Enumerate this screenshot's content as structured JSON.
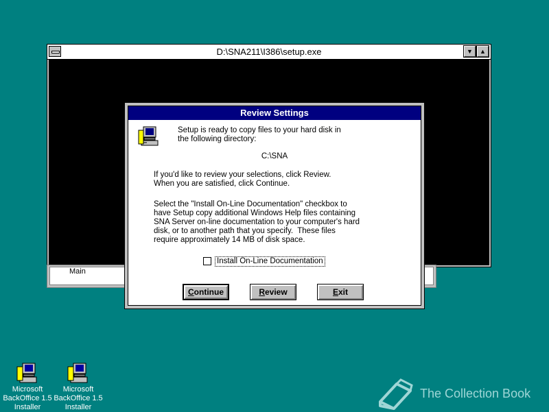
{
  "setup_window": {
    "title": "D:\\SNA211\\I386\\setup.exe"
  },
  "behind_window": {
    "tab_label": "Main"
  },
  "dialog": {
    "title": "Review Settings",
    "intro_line1": "Setup is ready to copy files to your hard disk in",
    "intro_line2": "the following directory:",
    "directory": "C:\\SNA",
    "review_line1": "If you'd like to review your selections, click Review.",
    "review_line2": "When you are satisfied, click Continue.",
    "doc_line1": "Select the \"Install On-Line Documentation\" checkbox to",
    "doc_line2": "have Setup copy additional Windows Help files containing",
    "doc_line3": "SNA Server on-line documentation to your computer's hard",
    "doc_line4": "disk, or to another path that you specify.  These files",
    "doc_line5": "require approximately 14 MB of disk space.",
    "checkbox_label": "Install On-Line Documentation",
    "checkbox_checked": false,
    "buttons": {
      "continue_key": "C",
      "continue_rest": "ontinue",
      "review_key": "R",
      "review_rest": "eview",
      "exit_key": "E",
      "exit_rest": "xit"
    }
  },
  "desktop_icons": [
    {
      "label": "Microsoft\nBackOffice 1.5\nInstaller"
    },
    {
      "label": "Microsoft\nBackOffice 1.5\nInstaller"
    }
  ],
  "watermark": {
    "text": "The Collection Book"
  },
  "colors": {
    "desktop": "#008080",
    "dialog_title": "#000080"
  }
}
